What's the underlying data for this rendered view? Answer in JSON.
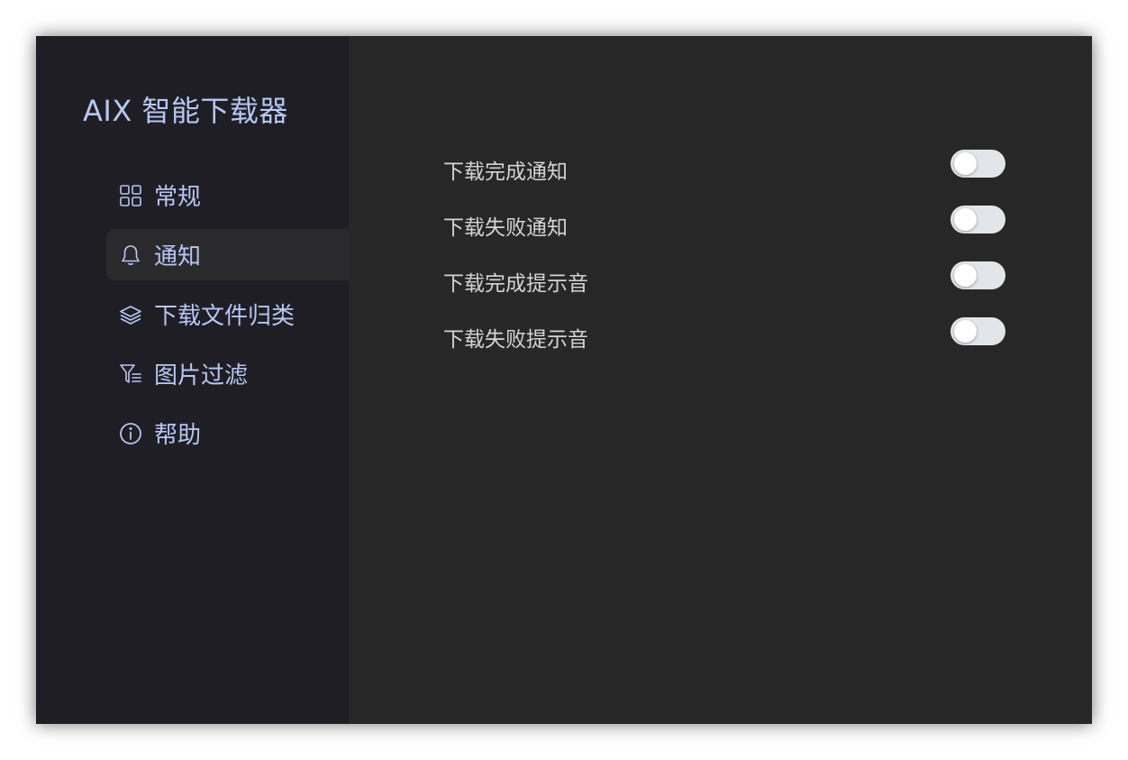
{
  "app": {
    "title": "AIX 智能下载器"
  },
  "sidebar": {
    "items": [
      {
        "label": "常规",
        "icon": "grid-icon",
        "active": false
      },
      {
        "label": "通知",
        "icon": "bell-icon",
        "active": true
      },
      {
        "label": "下载文件归类",
        "icon": "layers-icon",
        "active": false
      },
      {
        "label": "图片过滤",
        "icon": "filter-icon",
        "active": false
      },
      {
        "label": "帮助",
        "icon": "info-icon",
        "active": false
      }
    ]
  },
  "settings": {
    "items": [
      {
        "label": "下载完成通知",
        "enabled": false
      },
      {
        "label": "下载失败通知",
        "enabled": false
      },
      {
        "label": "下载完成提示音",
        "enabled": false
      },
      {
        "label": "下载失败提示音",
        "enabled": false
      }
    ]
  },
  "colors": {
    "sidebar_bg": "#1f1e24",
    "main_bg": "#272727",
    "accent_text": "#b7c7f2",
    "label_text": "#d4d4d4",
    "toggle_off": "#e2e5ea"
  }
}
